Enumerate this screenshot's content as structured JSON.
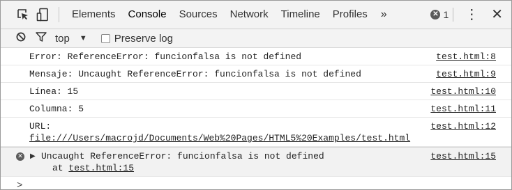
{
  "toolbar": {
    "tabs": [
      "Elements",
      "Console",
      "Sources",
      "Network",
      "Timeline",
      "Profiles"
    ],
    "more": "»",
    "error_count": "1"
  },
  "filter": {
    "context": "top",
    "preserve_log": "Preserve log"
  },
  "log": {
    "rows": [
      {
        "msg": "Error: ReferenceError: funcionfalsa is not defined",
        "src": "test.html:8"
      },
      {
        "msg": "Mensaje: Uncaught ReferenceError: funcionfalsa is not defined",
        "src": "test.html:9"
      },
      {
        "msg": "Línea: 15",
        "src": "test.html:10"
      },
      {
        "msg": "Columna: 5",
        "src": "test.html:11"
      }
    ],
    "url_row": {
      "label": "URL: ",
      "link": "file:///Users/macrojd/Documents/Web%20Pages/HTML5%20Examples/test.html",
      "src": "test.html:12"
    },
    "error_row": {
      "msg": "Uncaught ReferenceError: funcionfalsa is not defined",
      "at_prefix": "at ",
      "at_link": "test.html:15",
      "src": "test.html:15"
    }
  },
  "prompt": ">"
}
